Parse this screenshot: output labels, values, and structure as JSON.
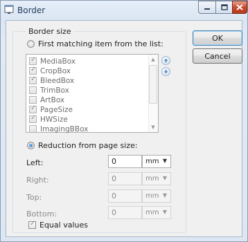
{
  "window": {
    "title": "Border",
    "icon": "window-icon"
  },
  "group": {
    "title": "Border size"
  },
  "first_matching": {
    "label": "First matching item from the list:",
    "selected": false
  },
  "list_items": [
    {
      "label": "MediaBox",
      "checked": true
    },
    {
      "label": "CropBox",
      "checked": true
    },
    {
      "label": "BleedBox",
      "checked": true
    },
    {
      "label": "TrimBox",
      "checked": false
    },
    {
      "label": "ArtBox",
      "checked": false
    },
    {
      "label": "PageSize",
      "checked": true
    },
    {
      "label": "HWSize",
      "checked": true
    },
    {
      "label": "ImagingBBox",
      "checked": false
    }
  ],
  "reduction": {
    "label": "Reduction from page size:",
    "selected": true
  },
  "dimensions": {
    "left": {
      "label": "Left:",
      "value": "0",
      "unit": "mm"
    },
    "right": {
      "label": "Right:",
      "value": "0",
      "unit": "mm"
    },
    "top": {
      "label": "Top:",
      "value": "0",
      "unit": "mm"
    },
    "bottom": {
      "label": "Bottom:",
      "value": "0",
      "unit": "mm"
    }
  },
  "equal_values": {
    "label": "Equal values",
    "checked": true
  },
  "buttons": {
    "ok": "OK",
    "cancel": "Cancel"
  }
}
